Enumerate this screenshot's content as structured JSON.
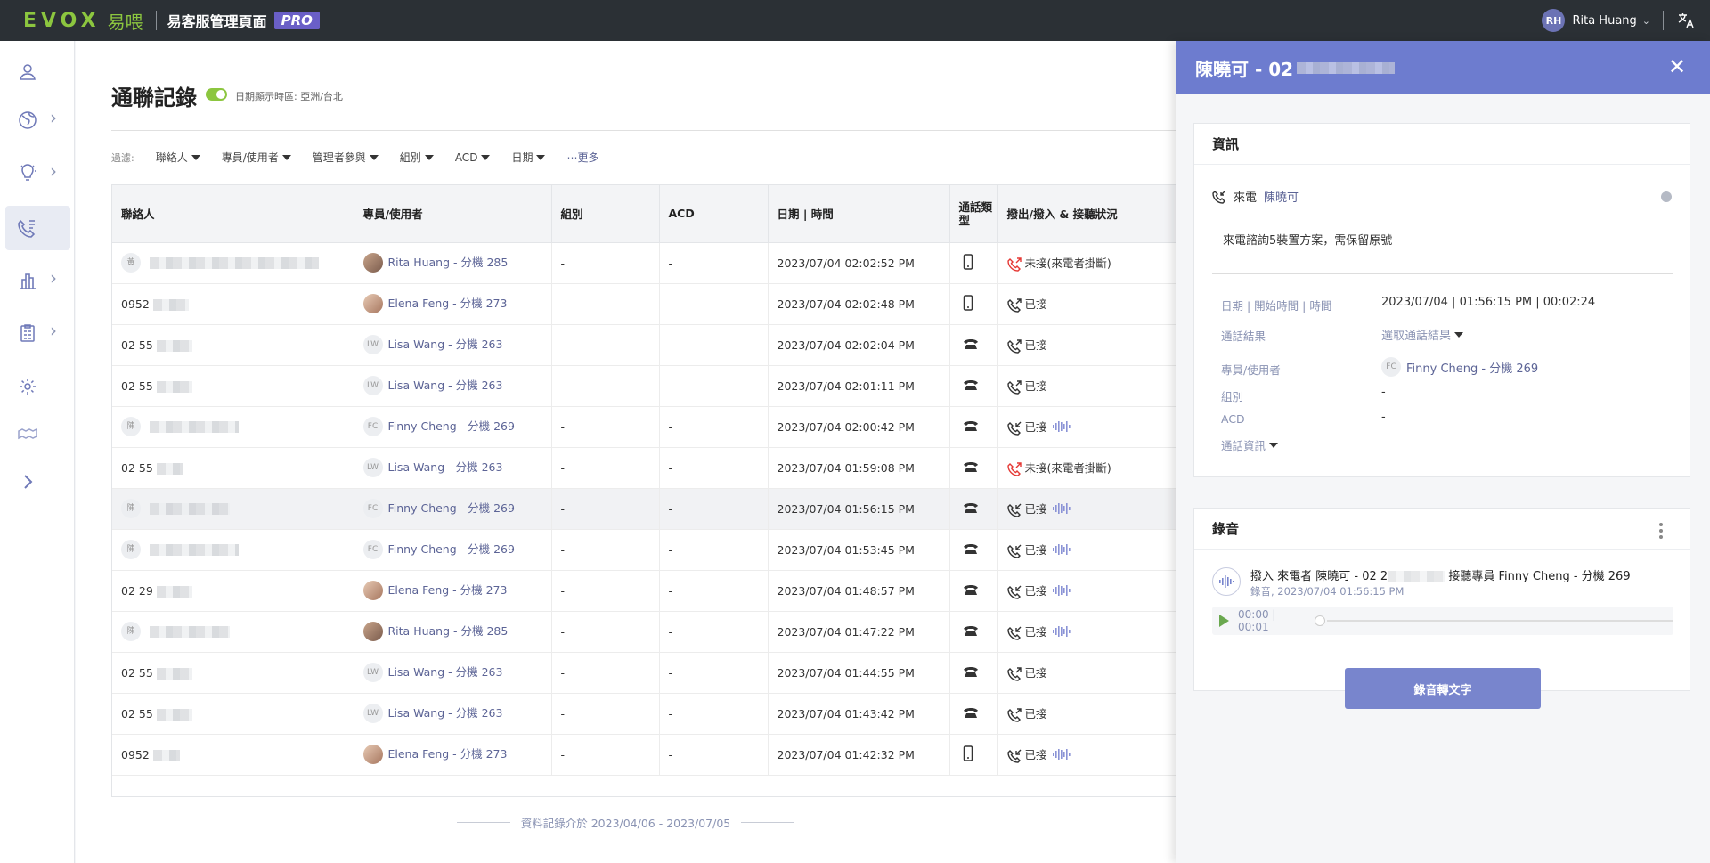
{
  "topbar": {
    "logo_word": "EVOX",
    "logo_cn": "易喂",
    "app_title": "易客服管理頁面",
    "pro_badge": "PRO",
    "user_initials": "RH",
    "user_name": "Rita Huang"
  },
  "sidebar": {
    "items": [
      {
        "icon": "user-icon",
        "has_arrow": false,
        "active": false
      },
      {
        "icon": "globe-icon",
        "has_arrow": true,
        "active": false
      },
      {
        "icon": "lightbulb-icon",
        "has_arrow": true,
        "active": false
      },
      {
        "icon": "call-log-icon",
        "has_arrow": false,
        "active": true
      },
      {
        "icon": "bar-chart-icon",
        "has_arrow": true,
        "active": false
      },
      {
        "icon": "clipboard-icon",
        "has_arrow": true,
        "active": false
      },
      {
        "icon": "gear-icon",
        "has_arrow": false,
        "active": false
      },
      {
        "icon": "handshake-icon",
        "has_arrow": false,
        "active": false
      },
      {
        "icon": "expand-icon",
        "has_arrow": false,
        "active": false
      }
    ]
  },
  "main": {
    "title": "通聯記錄",
    "timezone_label": "日期顯示時區: 亞洲/台北",
    "filters_label": "過濾:",
    "filters": [
      "聯絡人",
      "專員/使用者",
      "管理者參與",
      "組別",
      "ACD",
      "日期"
    ],
    "more_label": "⋯更多",
    "columns": [
      "聯絡人",
      "專員/使用者",
      "組別",
      "ACD",
      "日期 | 時間",
      "通話類型",
      "撥出/撥入 & 接聽狀況"
    ],
    "rows": [
      {
        "contact": "",
        "avatar": "",
        "agent": "Rita Huang - 分機 285",
        "agent_av": "photo",
        "group": "-",
        "acd": "-",
        "datetime": "2023/07/04 02:02:52 PM",
        "type": "mobile",
        "direction": "miss",
        "status": "未接(來電者掛斷)",
        "rec": false
      },
      {
        "contact": "0952",
        "avatar": "",
        "agent": "Elena Feng - 分機 273",
        "agent_av": "photo2",
        "group": "-",
        "acd": "-",
        "datetime": "2023/07/04 02:02:48 PM",
        "type": "mobile",
        "direction": "out",
        "status": "已接",
        "rec": false
      },
      {
        "contact": "02 55",
        "avatar": "",
        "agent": "Lisa Wang - 分機 263",
        "agent_av": "LW",
        "group": "-",
        "acd": "-",
        "datetime": "2023/07/04 02:02:04 PM",
        "type": "desk",
        "direction": "out",
        "status": "已接",
        "rec": false
      },
      {
        "contact": "02 55",
        "avatar": "",
        "agent": "Lisa Wang - 分機 263",
        "agent_av": "LW",
        "group": "-",
        "acd": "-",
        "datetime": "2023/07/04 02:01:11 PM",
        "type": "desk",
        "direction": "out",
        "status": "已接",
        "rec": false
      },
      {
        "contact": "",
        "avatar": "陳",
        "agent": "Finny Cheng - 分機 269",
        "agent_av": "FC",
        "group": "-",
        "acd": "-",
        "datetime": "2023/07/04 02:00:42 PM",
        "type": "desk",
        "direction": "in",
        "status": "已接",
        "rec": true
      },
      {
        "contact": "02 55",
        "avatar": "",
        "agent": "Lisa Wang - 分機 263",
        "agent_av": "LW",
        "group": "-",
        "acd": "-",
        "datetime": "2023/07/04 01:59:08 PM",
        "type": "desk",
        "direction": "miss",
        "status": "未接(來電者掛斷)",
        "rec": false
      },
      {
        "contact": "",
        "avatar": "陳",
        "agent": "Finny Cheng - 分機 269",
        "agent_av": "FC",
        "group": "-",
        "acd": "-",
        "datetime": "2023/07/04 01:56:15 PM",
        "type": "desk",
        "direction": "in",
        "status": "已接",
        "rec": true,
        "highlight": true
      },
      {
        "contact": "",
        "avatar": "陳",
        "agent": "Finny Cheng - 分機 269",
        "agent_av": "FC",
        "group": "-",
        "acd": "-",
        "datetime": "2023/07/04 01:53:45 PM",
        "type": "desk",
        "direction": "in",
        "status": "已接",
        "rec": true
      },
      {
        "contact": "02 29",
        "avatar": "",
        "agent": "Elena Feng - 分機 273",
        "agent_av": "photo2",
        "group": "-",
        "acd": "-",
        "datetime": "2023/07/04 01:48:57 PM",
        "type": "desk",
        "direction": "in",
        "status": "已接",
        "rec": true
      },
      {
        "contact": "",
        "avatar": "陳",
        "agent": "Rita Huang - 分機 285",
        "agent_av": "photo",
        "group": "-",
        "acd": "-",
        "datetime": "2023/07/04 01:47:22 PM",
        "type": "desk",
        "direction": "in",
        "status": "已接",
        "rec": true
      },
      {
        "contact": "02 55",
        "avatar": "",
        "agent": "Lisa Wang - 分機 263",
        "agent_av": "LW",
        "group": "-",
        "acd": "-",
        "datetime": "2023/07/04 01:44:55 PM",
        "type": "desk",
        "direction": "out",
        "status": "已接",
        "rec": false
      },
      {
        "contact": "02 55",
        "avatar": "",
        "agent": "Lisa Wang - 分機 263",
        "agent_av": "LW",
        "group": "-",
        "acd": "-",
        "datetime": "2023/07/04 01:43:42 PM",
        "type": "desk",
        "direction": "out",
        "status": "已接",
        "rec": false
      },
      {
        "contact": "0952",
        "avatar": "",
        "agent": "Elena Feng - 分機 273",
        "agent_av": "photo2",
        "group": "-",
        "acd": "-",
        "datetime": "2023/07/04 01:42:32 PM",
        "type": "mobile",
        "direction": "in",
        "status": "已接",
        "rec": true
      }
    ],
    "footer_note": "資料記錄介於 2023/04/06 - 2023/07/05"
  },
  "panel": {
    "title": "陳曉可 - 02",
    "info_card_title": "資訊",
    "call_direction": "來電",
    "contact_name": "陳曉可",
    "note": "來電諮詢5裝置方案，需保留原號",
    "fields": [
      {
        "label": "日期 | 開始時間 | 時間",
        "value": "2023/07/04 | 01:56:15 PM | 00:02:24"
      },
      {
        "label": "通話結果",
        "value": "選取通話結果"
      },
      {
        "label": "專員/使用者",
        "value": "Finny Cheng - 分機 269"
      },
      {
        "label": "組別",
        "value": "-"
      },
      {
        "label": "ACD",
        "value": "-"
      }
    ],
    "call_info_toggle": "通話資訊",
    "agent_initials": "FC",
    "recording_card_title": "錄音",
    "rec_line1": "撥入 來電者 陳曉可 - 02 2",
    "rec_line1_suffix": "接聽專員 Finny Cheng - 分機 269",
    "rec_line2": "錄音, 2023/07/04 01:56:15 PM",
    "player_time": "00:00 | 00:01",
    "transcribe_button": "錄音轉文字"
  },
  "colors": {
    "accent": "#6d7ccf",
    "brand_green": "#8cc63f",
    "topbar": "#2b3035",
    "miss_red": "#e53935",
    "link": "#5c6496"
  }
}
